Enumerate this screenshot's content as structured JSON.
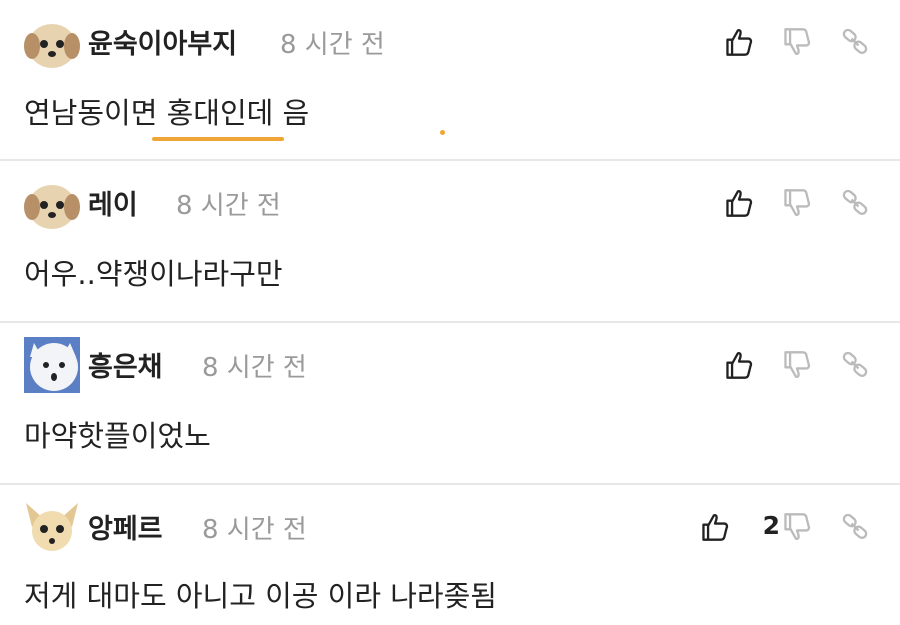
{
  "comments": [
    {
      "author": "윤숙이아부지",
      "time": "8 시간 전",
      "text": "연남동이면 홍대인데 음",
      "avatar": "puppy-face-icon"
    },
    {
      "author": "레이",
      "time": "8 시간 전",
      "text": "어우..약쟁이나라구만",
      "avatar": "puppy-face-icon"
    },
    {
      "author": "흥은채",
      "time": "8 시간 전",
      "text": "마약핫플이었노",
      "avatar": "white-dog-face-icon"
    },
    {
      "author": "앙페르",
      "time": "8 시간 전",
      "text": "저게 대마도 아니고 이공 이라 나라좆됨",
      "avatar": "chihuahua-face-icon",
      "likes": "2"
    }
  ],
  "colors": {
    "accent": "#f0a637",
    "divider": "#e7e7e7",
    "muted": "#9a9a9a",
    "text": "#222222"
  }
}
